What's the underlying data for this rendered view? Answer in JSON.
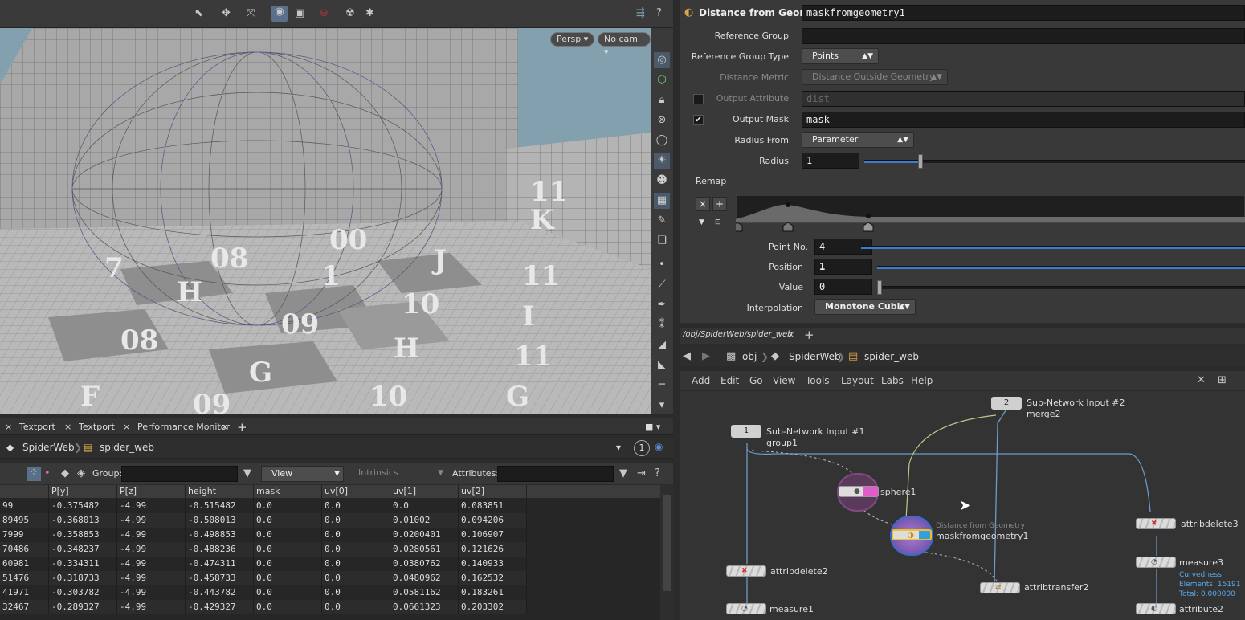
{
  "viewport": {
    "view_menu": "Persp",
    "camera_menu": "No cam",
    "tile_labels": [
      "08",
      "00",
      "J",
      "1",
      "H",
      "7",
      "09",
      "I",
      "10",
      "H",
      "08",
      "G",
      "F",
      "10",
      "11",
      "G",
      "09",
      "11",
      "K",
      "11"
    ]
  },
  "toolbar_icons": [
    "select-icon",
    "transform-icon",
    "handle-icon",
    "camera-icon",
    "snapshot-icon",
    "no-entry-icon",
    "render-icon",
    "settings-icon"
  ],
  "lower_tabs": [
    {
      "label": "Textport"
    },
    {
      "label": "Textport"
    },
    {
      "label": "Performance Monitor"
    }
  ],
  "left_path": {
    "root": "SpiderWeb",
    "child": "spider_web",
    "count": "1"
  },
  "spreadsheet": {
    "group_label": "Group:",
    "view_label": "View",
    "intrinsics_label": "Intrinsics",
    "attributes_label": "Attributes:",
    "columns": [
      "",
      "P[y]",
      "P[z]",
      "height",
      "mask",
      "uv[0]",
      "uv[1]",
      "uv[2]"
    ],
    "rows": [
      [
        "99",
        "-0.375482",
        "-4.99",
        "-0.515482",
        "0.0",
        "0.0",
        "0.0",
        "0.083851"
      ],
      [
        "89495",
        "-0.368013",
        "-4.99",
        "-0.508013",
        "0.0",
        "0.0",
        "0.01002",
        "0.094206"
      ],
      [
        "7999",
        "-0.358853",
        "-4.99",
        "-0.498853",
        "0.0",
        "0.0",
        "0.0200401",
        "0.106907"
      ],
      [
        "70486",
        "-0.348237",
        "-4.99",
        "-0.488236",
        "0.0",
        "0.0",
        "0.0280561",
        "0.121626"
      ],
      [
        "60981",
        "-0.334311",
        "-4.99",
        "-0.474311",
        "0.0",
        "0.0",
        "0.0380762",
        "0.140933"
      ],
      [
        "51476",
        "-0.318733",
        "-4.99",
        "-0.458733",
        "0.0",
        "0.0",
        "0.0480962",
        "0.162532"
      ],
      [
        "41971",
        "-0.303782",
        "-4.99",
        "-0.443782",
        "0.0",
        "0.0",
        "0.0581162",
        "0.183261"
      ],
      [
        "32467",
        "-0.289327",
        "-4.99",
        "-0.429327",
        "0.0",
        "0.0",
        "0.0661323",
        "0.203302"
      ]
    ]
  },
  "params": {
    "node_type": "Distance from Geometry",
    "node_name": "maskfromgeometry1",
    "reference_group_label": "Reference Group",
    "reference_group_value": "",
    "reference_group_type_label": "Reference Group Type",
    "reference_group_type_value": "Points",
    "distance_metric_label": "Distance Metric",
    "distance_metric_value": "Distance Outside Geometry",
    "output_attribute_label": "Output Attribute",
    "output_attribute_value": "dist",
    "output_mask_label": "Output Mask",
    "output_mask_value": "mask",
    "radius_from_label": "Radius From",
    "radius_from_value": "Parameter",
    "radius_label": "Radius",
    "radius_value": "1",
    "remap_label": "Remap",
    "point_no_label": "Point No.",
    "point_no_value": "4",
    "position_label": "Position",
    "position_value": "1",
    "value_label": "Value",
    "value_value": "0",
    "interpolation_label": "Interpolation",
    "interpolation_value": "Monotone Cubic"
  },
  "network": {
    "tab_path": "/obj/SpiderWeb/spider_web",
    "path_root": "obj",
    "path_mid": "SpiderWeb",
    "path_leaf": "spider_web",
    "menus": [
      "Add",
      "Edit",
      "Go",
      "View",
      "Tools",
      "Layout",
      "Labs",
      "Help"
    ],
    "nodes": {
      "input1_num": "1",
      "input1_label": "Sub-Network Input #1",
      "input1_group": "group1",
      "input2_num": "2",
      "input2_label": "Sub-Network Input #2",
      "input2_group": "merge2",
      "sphere": "sphere1",
      "mask_type": "Distance from Geometry",
      "mask_name": "maskfromgeometry1",
      "attribdelete3": "attribdelete3",
      "measure3": "measure3",
      "curvedness": "Curvedness",
      "elements": "Elements: 15191",
      "total": "Total: 0.000000",
      "attribdelete2": "attribdelete2",
      "attribtransfer2": "attribtransfer2",
      "measure1": "measure1",
      "attribute2": "attribute2"
    }
  }
}
